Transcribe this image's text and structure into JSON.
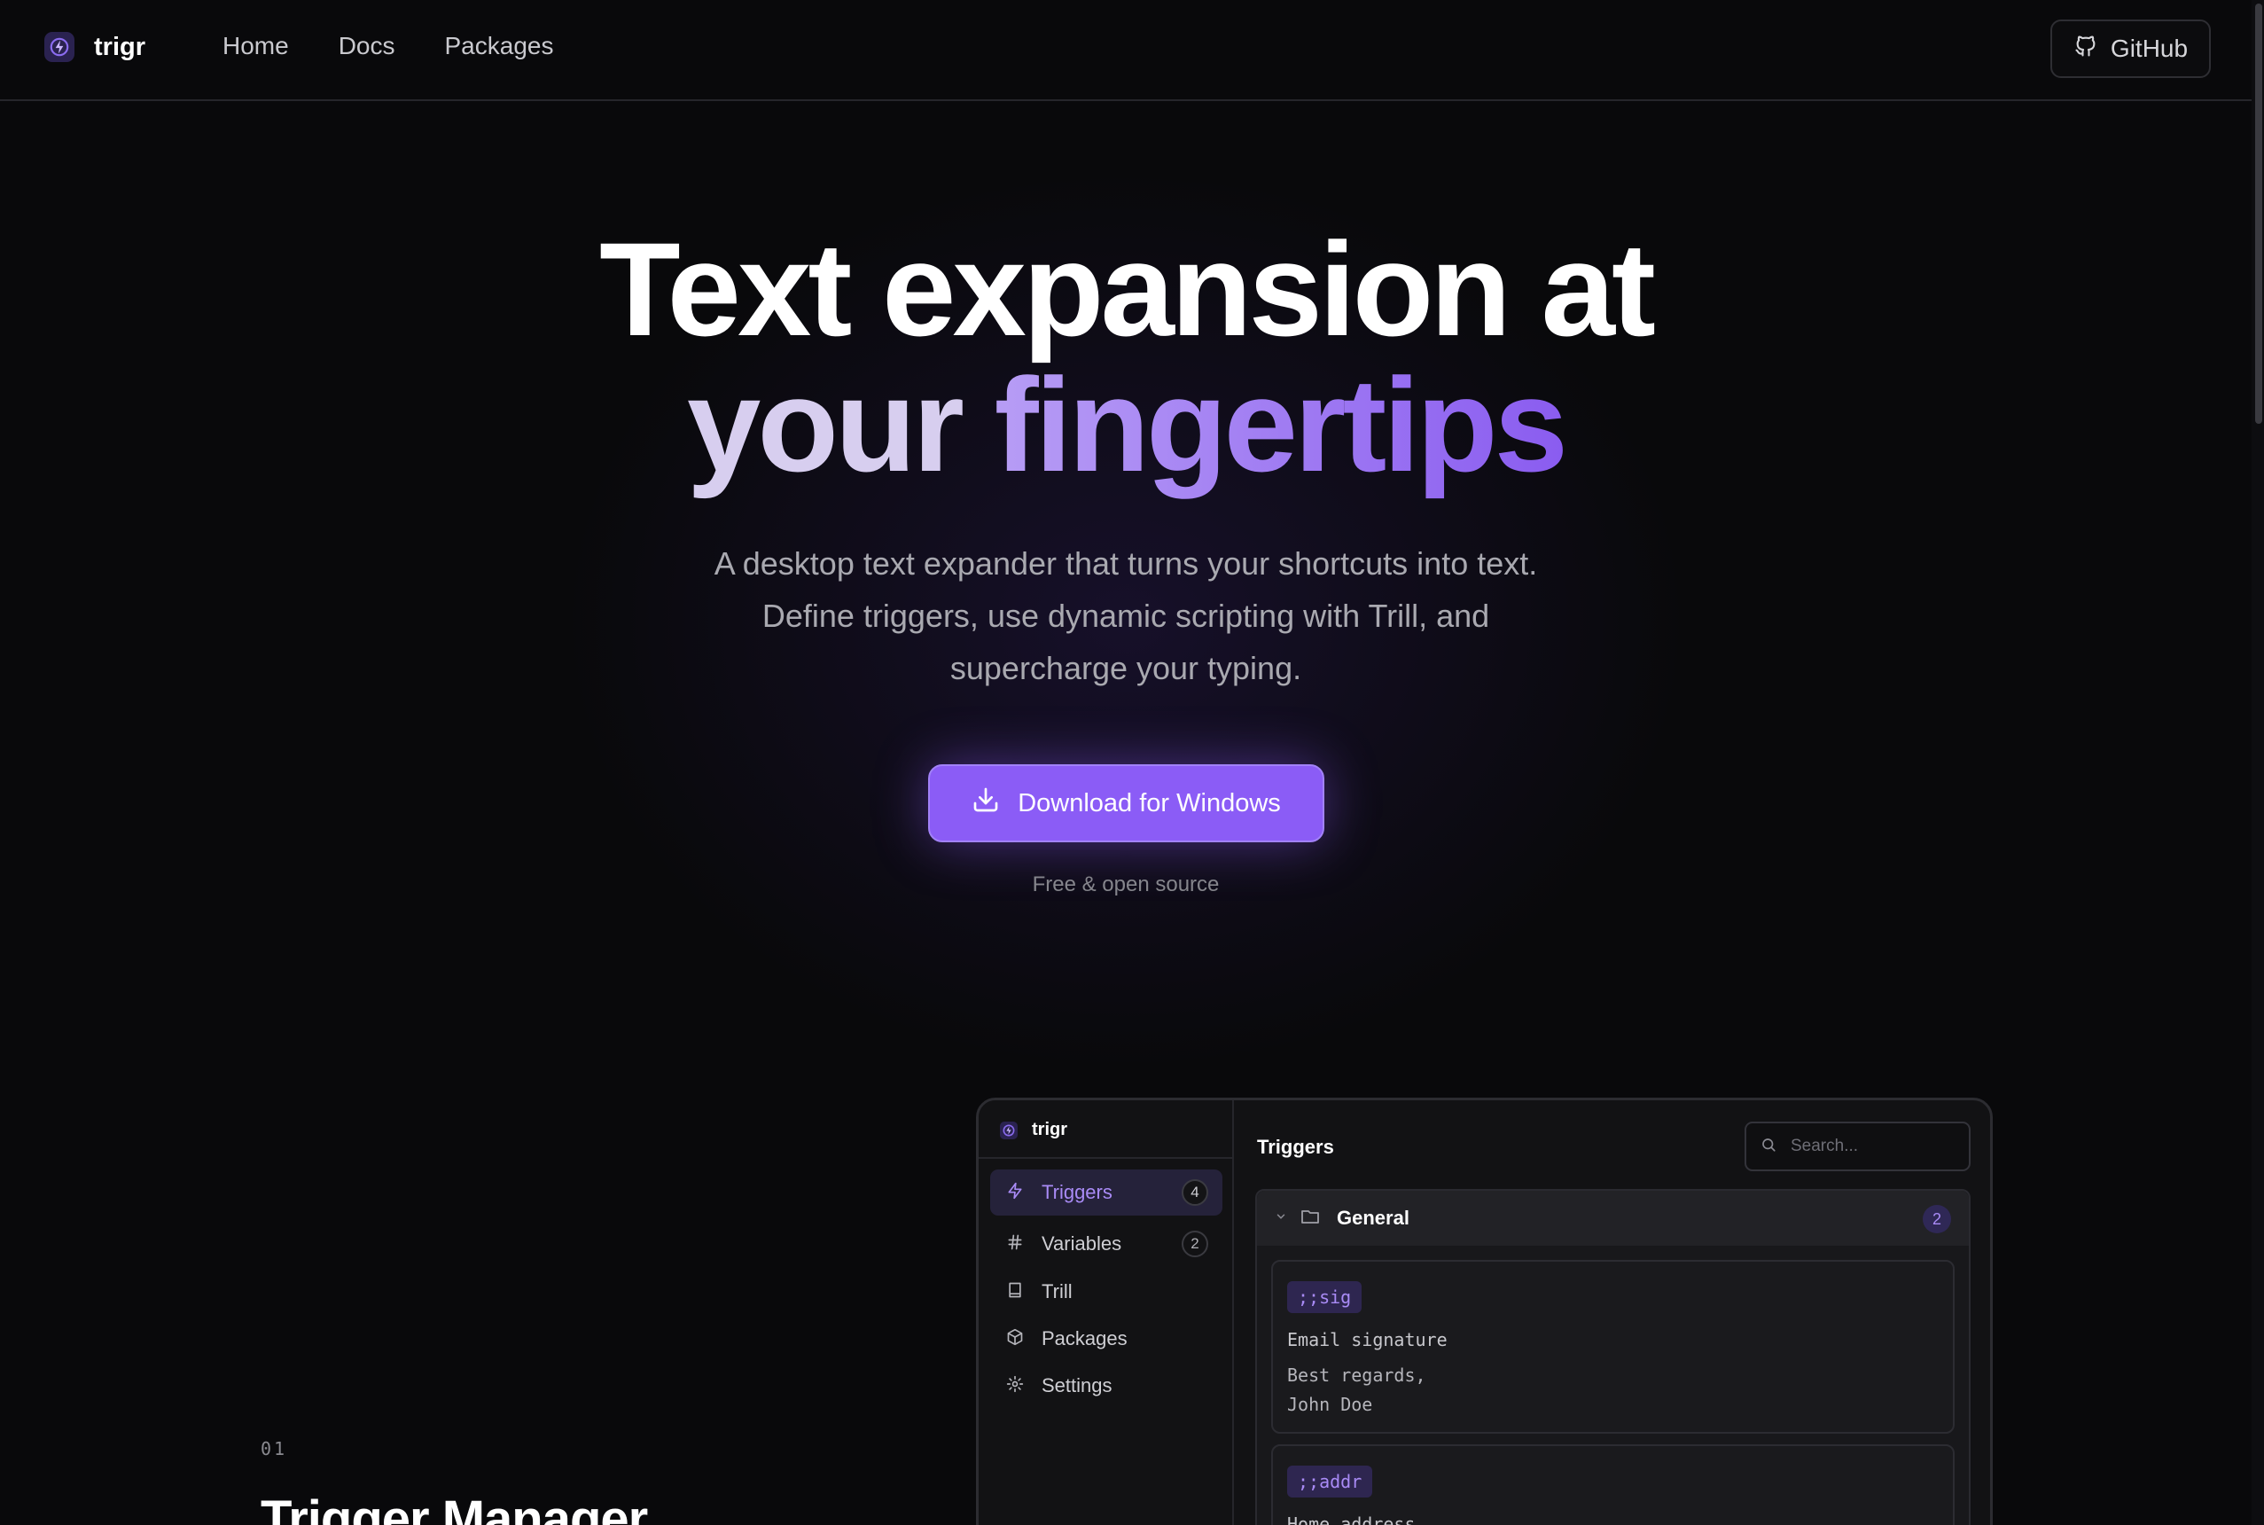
{
  "nav": {
    "brand": "trigr",
    "links": [
      {
        "label": "Home"
      },
      {
        "label": "Docs"
      },
      {
        "label": "Packages"
      }
    ],
    "github_label": "GitHub"
  },
  "hero": {
    "title_line1": "Text expansion at",
    "title_line2_a": "your",
    "title_line2_b": "fingertips",
    "subtitle_lines": [
      "A desktop text expander that turns your shortcuts into text.",
      "Define triggers, use dynamic scripting with Trill, and",
      "supercharge your typing."
    ],
    "download_label": "Download for Windows",
    "note": "Free & open source"
  },
  "feature": {
    "number": "01",
    "title": "Trigger Manager"
  },
  "app": {
    "brand": "trigr",
    "sidebar": [
      {
        "label": "Triggers",
        "count": "4",
        "icon": "lightning-icon",
        "active": true
      },
      {
        "label": "Variables",
        "count": "2",
        "icon": "hash-icon",
        "active": false
      },
      {
        "label": "Trill",
        "count": null,
        "icon": "book-icon",
        "active": false
      },
      {
        "label": "Packages",
        "count": null,
        "icon": "package-icon",
        "active": false
      },
      {
        "label": "Settings",
        "count": null,
        "icon": "gear-icon",
        "active": false
      }
    ],
    "main_title": "Triggers",
    "search_placeholder": "Search...",
    "group": {
      "name": "General",
      "count": "2"
    },
    "cards": [
      {
        "trigger": ";;sig",
        "description": "Email signature",
        "body": [
          "Best regards,",
          "John Doe"
        ]
      },
      {
        "trigger": ";;addr",
        "description": "Home address",
        "body": []
      }
    ]
  },
  "colors": {
    "background": "#09090b",
    "accent": "#8b5cf6",
    "accent_light": "#a98bf6"
  }
}
